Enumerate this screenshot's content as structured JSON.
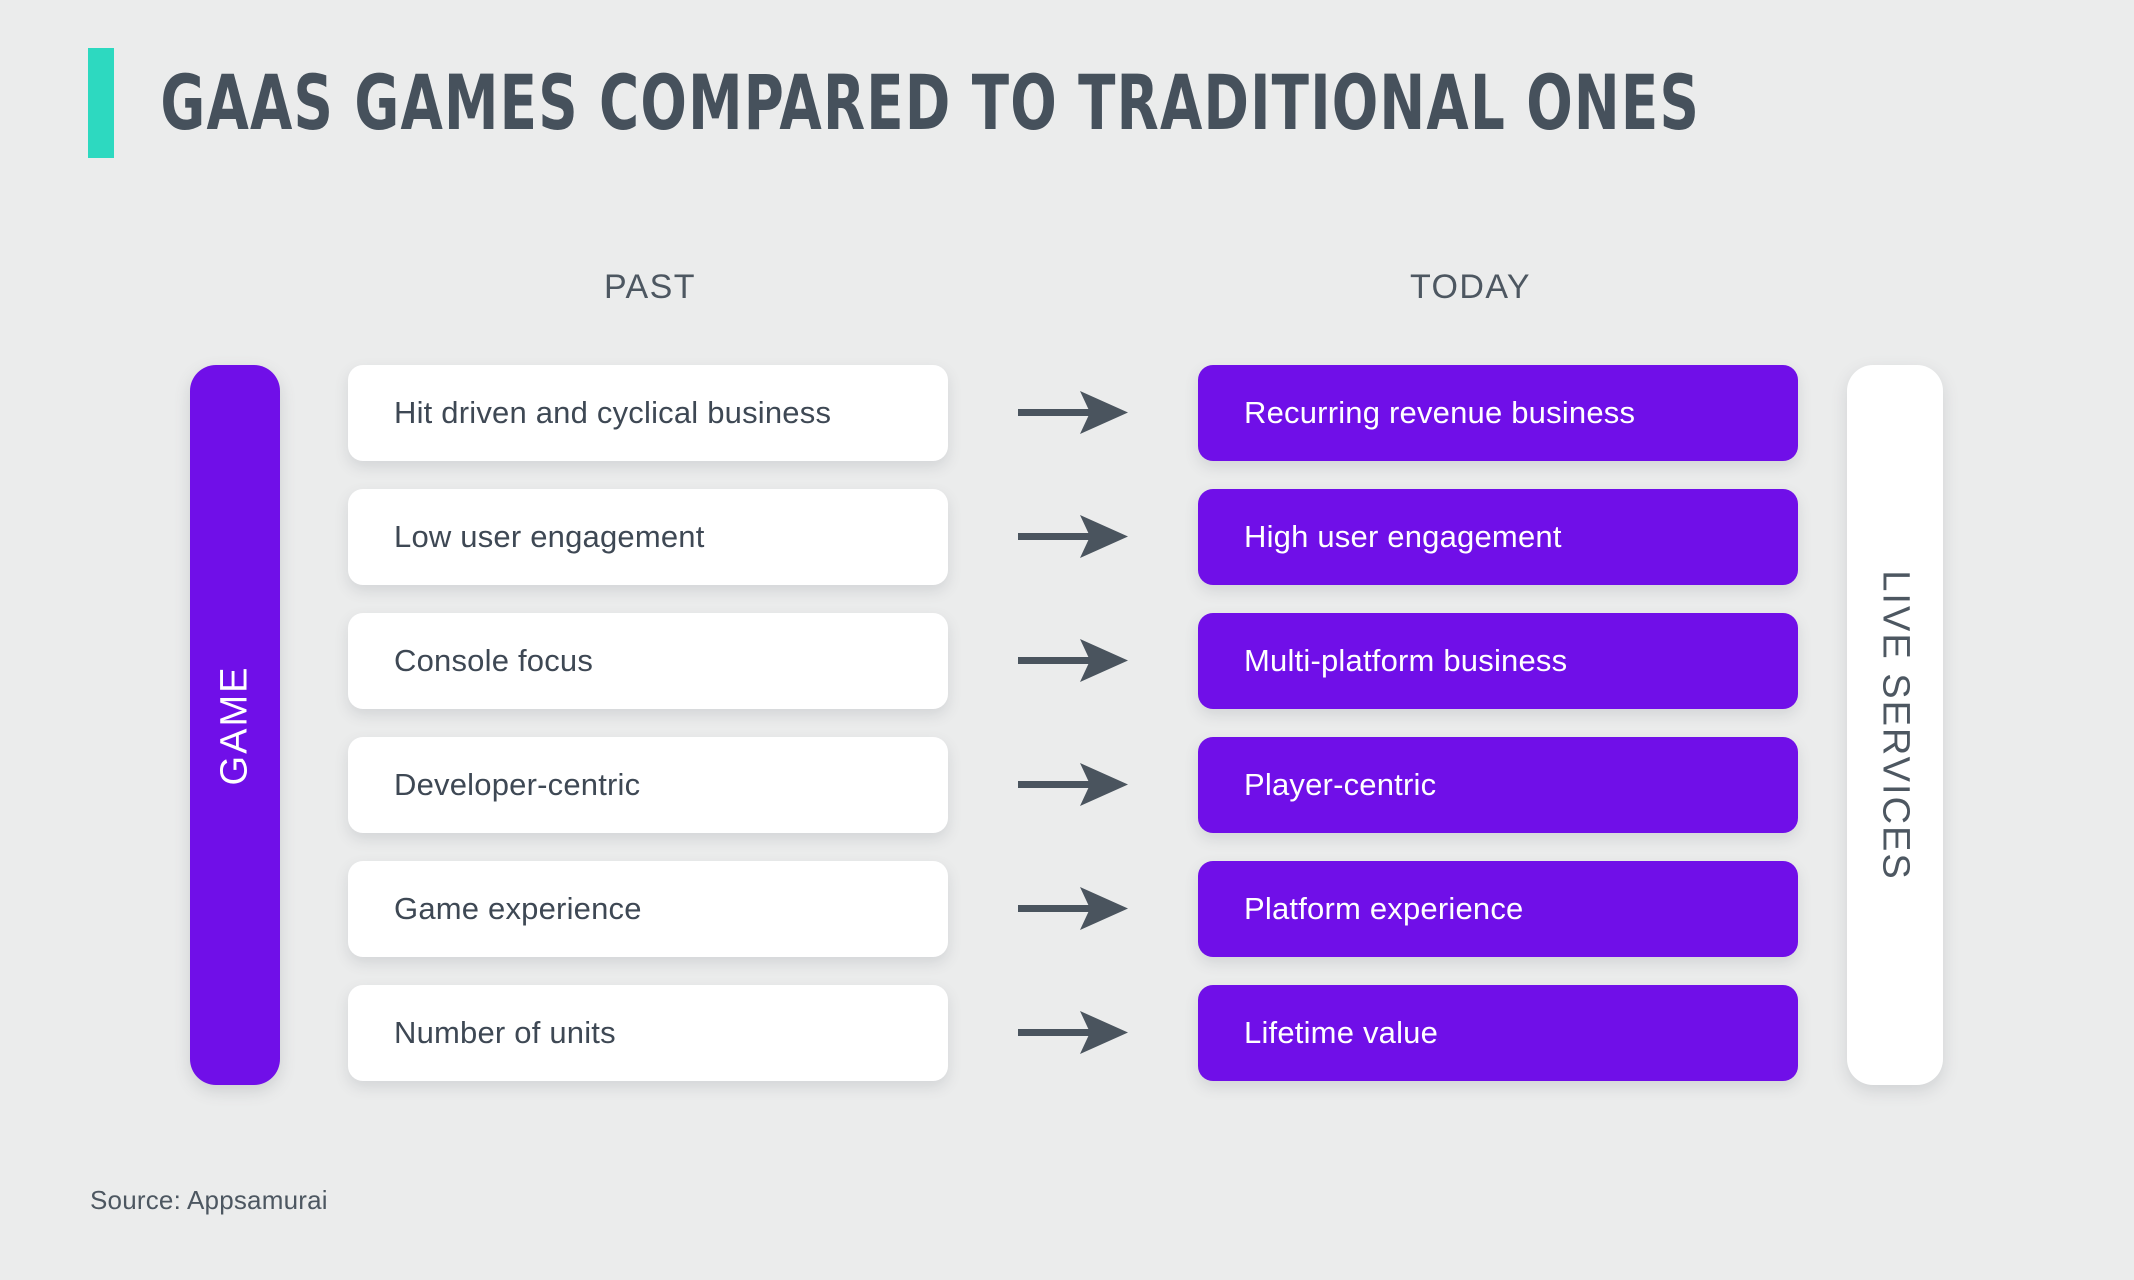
{
  "header": {
    "title": "GAAS GAMES COMPARED TO TRADITIONAL ONES",
    "accent_color": "#2dd9c0"
  },
  "columns": {
    "left_heading": "PAST",
    "right_heading": "TODAY"
  },
  "side_bars": {
    "left_label": "GAME",
    "right_label": "LIVE SERVICES"
  },
  "colors": {
    "background": "#ebecec",
    "purple": "#700fe8",
    "teal": "#2dd9c0",
    "text_dark": "#3e4854",
    "arrow": "#4a545e",
    "card_white": "#ffffff"
  },
  "icons": {
    "arrow": "arrow-right-icon"
  },
  "rows": [
    {
      "past": "Hit driven and cyclical business",
      "today": "Recurring revenue business"
    },
    {
      "past": "Low user engagement",
      "today": "High user engagement"
    },
    {
      "past": "Console focus",
      "today": "Multi-platform business"
    },
    {
      "past": "Developer-centric",
      "today": "Player-centric"
    },
    {
      "past": "Game experience",
      "today": "Platform experience"
    },
    {
      "past": "Number of units",
      "today": "Lifetime value"
    }
  ],
  "footer": {
    "source": "Source: Appsamurai"
  }
}
